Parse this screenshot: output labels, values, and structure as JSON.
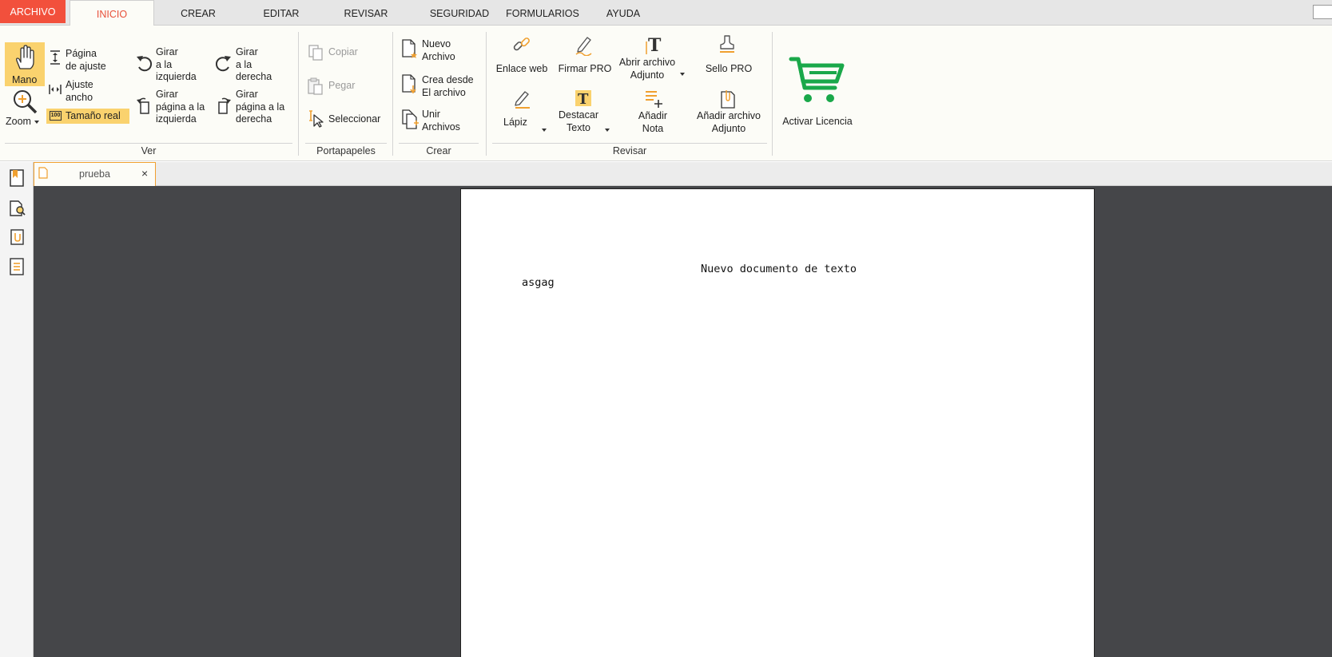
{
  "menu": {
    "archivo": "ARCHIVO",
    "inicio": "INICIO",
    "crear": "CREAR",
    "editar": "EDITAR",
    "revisar": "REVISAR",
    "seguridad": "SEGURIDAD",
    "formularios": "FORMULARIOS",
    "ayuda": "AYUDA"
  },
  "ribbon": {
    "ver": {
      "label": "Ver",
      "mano": "Mano",
      "zoom": "Zoom",
      "pagina_ajuste_1": "Página",
      "pagina_ajuste_2": "de ajuste",
      "ajuste_ancho_1": "Ajuste",
      "ajuste_ancho_2": "ancho",
      "tamano_real": "Tamaño real",
      "girar_izq_1": "Girar",
      "girar_izq_2": "a la",
      "girar_izq_3": "izquierda",
      "girar_der_1": "Girar",
      "girar_der_2": "a la",
      "girar_der_3": "derecha",
      "girar_pag_izq_1": "Girar",
      "girar_pag_izq_2": "página a la",
      "girar_pag_izq_3": "izquierda",
      "girar_pag_der_1": "Girar",
      "girar_pag_der_2": "página a la",
      "girar_pag_der_3": "derecha"
    },
    "portapapeles": {
      "label": "Portapapeles",
      "copiar": "Copiar",
      "pegar": "Pegar",
      "seleccionar": "Seleccionar"
    },
    "crear": {
      "label": "Crear",
      "nuevo_1": "Nuevo",
      "nuevo_2": "Archivo",
      "crea_1": "Crea desde",
      "crea_2": "El archivo",
      "unir_1": "Unir",
      "unir_2": "Archivos"
    },
    "revisar": {
      "label": "Revisar",
      "enlace_web": "Enlace web",
      "firmar_pro": "Firmar PRO",
      "abrir_adjunto_1": "Abrir archivo",
      "abrir_adjunto_2": "Adjunto",
      "sello_pro": "Sello PRO",
      "lapiz": "Lápiz",
      "destacar_1": "Destacar",
      "destacar_2": "Texto",
      "anadir_nota_1": "Añadir",
      "anadir_nota_2": "Nota",
      "anadir_adjunto_1": "Añadir archivo",
      "anadir_adjunto_2": "Adjunto"
    },
    "activar_licencia": "Activar Licencia"
  },
  "document_tab": {
    "name": "prueba",
    "close": "×"
  },
  "document": {
    "line1": "Nuevo documento de texto",
    "line2": "asgag"
  },
  "colors": {
    "accent_red": "#f2503c",
    "highlight_yellow": "#fad26e",
    "cart_green": "#1aa84a",
    "viewer_bg": "#454649"
  }
}
